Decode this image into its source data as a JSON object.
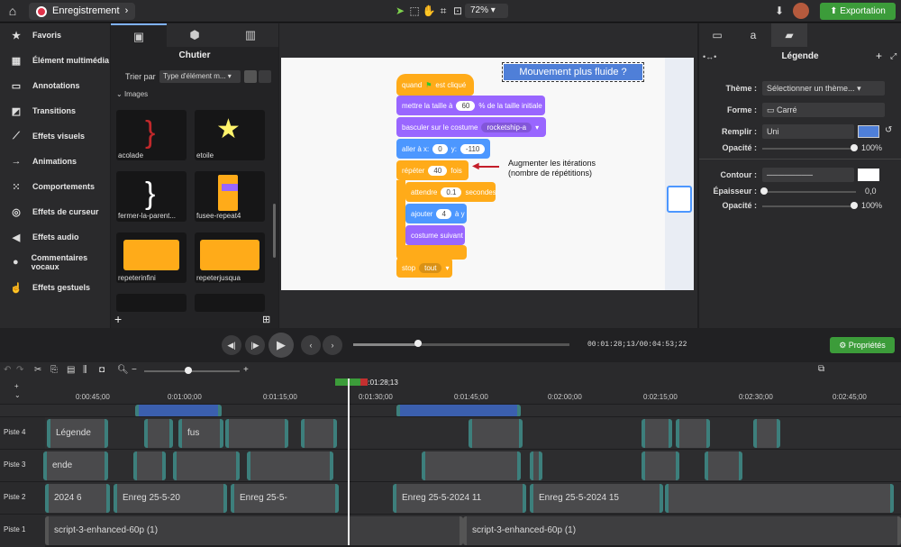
{
  "topbar": {
    "project_name": "Enregistrement",
    "zoom": "72%",
    "export_label": "Exportation"
  },
  "left_nav": {
    "items": [
      {
        "label": "Favoris",
        "icon": "star-icon"
      },
      {
        "label": "Élément multimédia",
        "icon": "film-icon"
      },
      {
        "label": "Annotations",
        "icon": "annotation-icon"
      },
      {
        "label": "Transitions",
        "icon": "transition-icon"
      },
      {
        "label": "Effets visuels",
        "icon": "wand-icon"
      },
      {
        "label": "Animations",
        "icon": "animation-icon"
      },
      {
        "label": "Comportements",
        "icon": "behavior-icon"
      },
      {
        "label": "Effets de curseur",
        "icon": "cursor-effect-icon"
      },
      {
        "label": "Effets audio",
        "icon": "speaker-icon"
      },
      {
        "label": "Commentaires vocaux",
        "icon": "microphone-icon"
      },
      {
        "label": "Effets gestuels",
        "icon": "hand-icon"
      }
    ]
  },
  "library": {
    "title": "Chutier",
    "sort_label": "Trier par",
    "sort_value": "Type d'élément m...",
    "section": "Images",
    "items": [
      {
        "label": "acolade"
      },
      {
        "label": "etoile"
      },
      {
        "label": "fermer-la-parent..."
      },
      {
        "label": "fusee-repeat4"
      },
      {
        "label": "repeterinfini"
      },
      {
        "label": "repeterjusqua"
      }
    ]
  },
  "stage": {
    "title_callout": "Mouvement plus fluide ?",
    "annotation": "Augmenter les itérations (nombre de répétitions)",
    "blocks": {
      "when_flag": "quand",
      "when_flag2": "est cliqué",
      "set_size": "mettre la taille à",
      "set_size_val": "60",
      "set_size_suffix": "% de la taille initiale",
      "switch_costume": "basculer sur le costume",
      "costume_val": "rocketship-a",
      "goto": "aller à x:",
      "goto_x": "0",
      "goto_y_label": "y:",
      "goto_y": "-110",
      "repeat": "répéter",
      "repeat_val": "40",
      "repeat_suffix": "fois",
      "wait": "attendre",
      "wait_val": "0.1",
      "wait_suffix": "secondes",
      "add": "ajouter",
      "add_val": "4",
      "add_suffix": "à y",
      "next_costume": "costume suivant",
      "stop": "stop",
      "stop_val": "tout"
    }
  },
  "props": {
    "title": "Légende",
    "theme_label": "Thème :",
    "theme_value": "Sélectionner un thème...",
    "shape_label": "Forme :",
    "shape_value": "Carré",
    "fill_label": "Remplir :",
    "fill_value": "Uni",
    "opacity_label": "Opacité :",
    "opacity_value": "100%",
    "outline_label": "Contour :",
    "thickness_label": "Épaisseur :",
    "thickness_value": "0,0",
    "opacity2_value": "100%",
    "fill_color": "#4f7fd8"
  },
  "playback": {
    "current_time": "00:01:28;13",
    "total_time": "00:04:53;22",
    "props_button": "Propriétés",
    "progress": 0.3
  },
  "timeline": {
    "playhead_time": "0:01:28;13",
    "ticks": [
      "0:00:45;00",
      "0:01:00;00",
      "0:01:15;00",
      "0:01:30;00",
      "0:01:45;00",
      "0:02:00;00",
      "0:02:15;00",
      "0:02:30;00",
      "0:02:45;00"
    ],
    "tracks": [
      {
        "name": "Piste 4",
        "clips": [
          "Légende",
          "fus"
        ]
      },
      {
        "name": "Piste 3",
        "clips": [
          "ende"
        ]
      },
      {
        "name": "Piste 2",
        "clips": [
          "2024 6",
          "Enreg 25-5-20",
          "Enreg 25-5-",
          "Enreg 25-5-2024 11",
          "Enreg 25-5-2024 15"
        ]
      },
      {
        "name": "Piste 1",
        "clips": [
          "script-3-enhanced-60p (1)",
          "script-3-enhanced-60p (1)"
        ]
      }
    ]
  }
}
